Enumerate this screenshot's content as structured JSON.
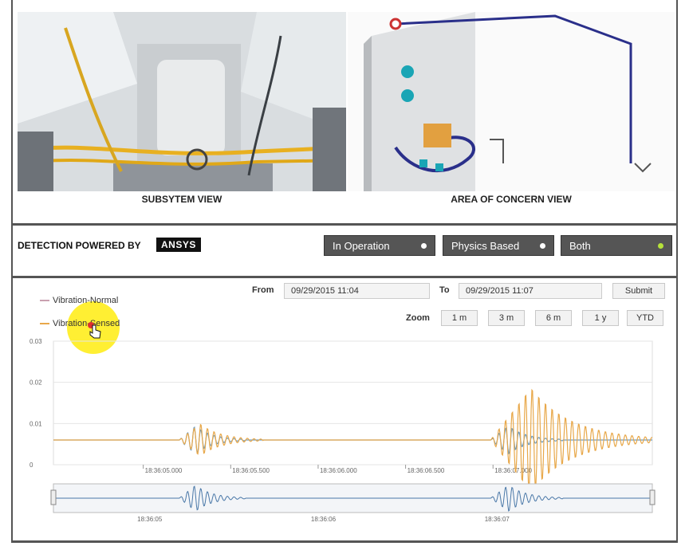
{
  "views": {
    "subsystem_caption": "SUBSYTEM VIEW",
    "concern_caption": "AREA OF CONCERN VIEW"
  },
  "detection": {
    "label": "DETECTION POWERED BY",
    "brand": "ANSYS",
    "modes": [
      {
        "label": "In Operation",
        "active": false
      },
      {
        "label": "Physics Based",
        "active": false
      },
      {
        "label": "Both",
        "active": true
      }
    ]
  },
  "range": {
    "from_label": "From",
    "from_value": "09/29/2015 11:04",
    "to_label": "To",
    "to_value": "09/29/2015 11:07",
    "submit_label": "Submit",
    "zoom_label": "Zoom",
    "zoom_options": [
      "1 m",
      "3 m",
      "6 m",
      "1 y",
      "YTD"
    ]
  },
  "legend": {
    "normal": "Vibration-Normal",
    "sensed": "Vibration-Sensed"
  },
  "colors": {
    "normal": "#6c9bc0",
    "sensed": "#e8a84a",
    "active_dot": "#b6e23a",
    "highlight": "#ffe600"
  },
  "chart_data": {
    "type": "line",
    "ylim": [
      0,
      0.03
    ],
    "y_ticks": [
      "0",
      "0.01",
      "0.02",
      "0.03"
    ],
    "x_ticks": [
      "18:36:05.000",
      "18:36:05.500",
      "18:36:06.000",
      "18:36:06.500",
      "18:36:07.000"
    ],
    "navigator_ticks": [
      "18:36:05",
      "18:36:06",
      "18:36:07"
    ],
    "series": [
      {
        "name": "Vibration-Normal",
        "baseline": 0.006,
        "bursts": [
          {
            "start": 0.21,
            "end": 0.32,
            "amplitude": 0.0035
          },
          {
            "start": 0.73,
            "end": 0.85,
            "amplitude": 0.0035
          }
        ]
      },
      {
        "name": "Vibration-Sensed",
        "baseline": 0.006,
        "bursts": [
          {
            "start": 0.21,
            "end": 0.35,
            "amplitude": 0.004
          },
          {
            "start": 0.73,
            "end": 1.0,
            "amplitude": 0.013
          }
        ]
      }
    ]
  }
}
